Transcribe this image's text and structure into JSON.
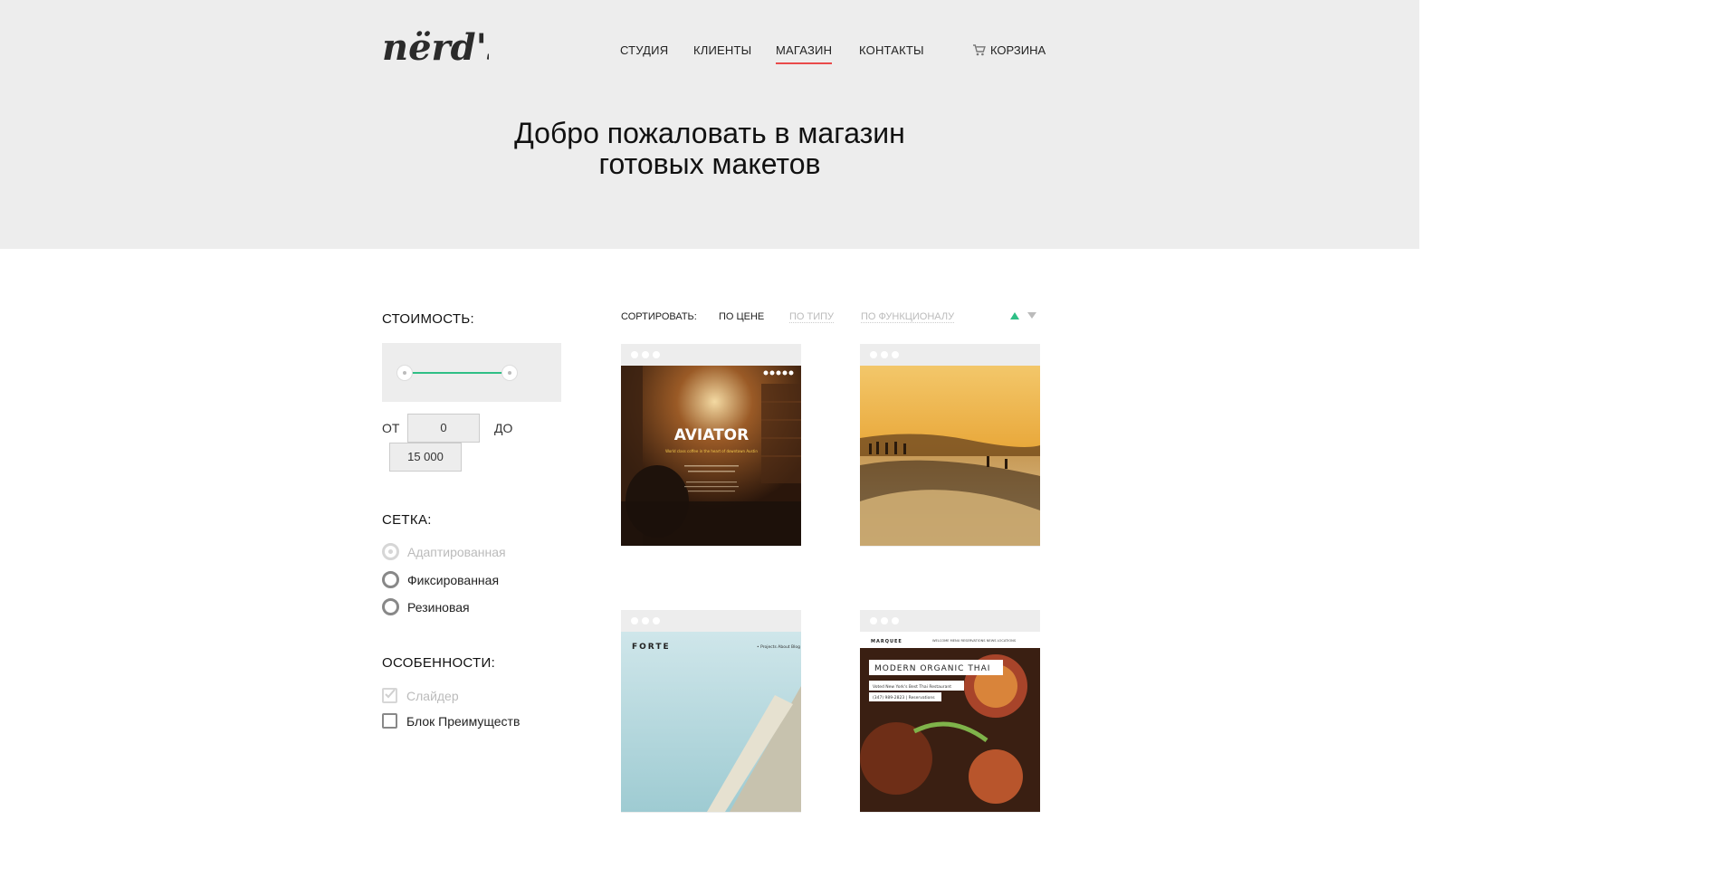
{
  "header": {
    "logo_text": "nërd's",
    "nav": [
      {
        "label": "СТУДИЯ",
        "active": false
      },
      {
        "label": "КЛИЕНТЫ",
        "active": false
      },
      {
        "label": "МАГАЗИН",
        "active": true
      },
      {
        "label": "КОНТАКТЫ",
        "active": false
      }
    ],
    "cart": {
      "label": "КОРЗИНА",
      "icon": "cart-icon"
    },
    "title_line1": "Добро пожаловать в магазин",
    "title_line2": "готовых макетов"
  },
  "filters": {
    "price": {
      "title": "СТОИМОСТЬ:",
      "from_label": "ОТ",
      "from_value": "0",
      "to_label": "ДО",
      "to_value": "15 000"
    },
    "grid": {
      "title": "СЕТКА:",
      "options": [
        {
          "label": "Адаптированная",
          "state": "disabled"
        },
        {
          "label": "Фиксированная",
          "state": "unchecked"
        },
        {
          "label": "Резиновая",
          "state": "unchecked"
        }
      ]
    },
    "features": {
      "title": "ОСОБЕННОСТИ:",
      "options": [
        {
          "label": "Слайдер",
          "state": "disabled"
        },
        {
          "label": "Блок Преимуществ",
          "state": "unchecked"
        }
      ]
    }
  },
  "sort": {
    "label": "СОРТИРОВАТЬ:",
    "options": [
      {
        "label": "ПО ЦЕНЕ",
        "active": true
      },
      {
        "label": "ПО ТИПУ",
        "active": false
      },
      {
        "label": "ПО ФУНКЦИОНАЛУ",
        "active": false
      }
    ],
    "direction": "ascending"
  },
  "products": [
    {
      "name": "AVIATOR",
      "tagline": "World class coffee in the heart of downtown Austin"
    },
    {
      "name": "",
      "tagline": ""
    },
    {
      "name": "FORTE",
      "nav": "• Projects   About   Blog"
    },
    {
      "name": "MARQUEE",
      "headline": "MODERN ORGANIC THAI",
      "tagline": "Voted New York's Best Thai Restaurant",
      "phone": "(347) 989-2823 | Reservations",
      "nav": "WELCOME   MENU   RESERVATIONS   NEWS   LOCATIONS"
    }
  ],
  "colors": {
    "hero_bg": "#ededed",
    "accent_green": "#2fbf86",
    "accent_red": "#e94b4b"
  }
}
